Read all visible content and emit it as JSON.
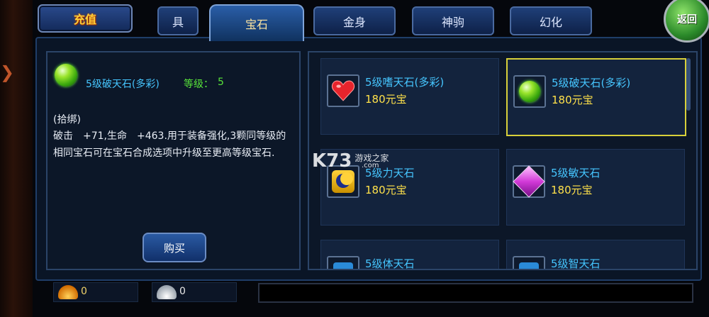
{
  "tabs": {
    "recharge": "充值",
    "partial_tab": "具",
    "gem": "宝石",
    "golden_body": "金身",
    "steed": "神驹",
    "transform": "幻化",
    "back": "返回"
  },
  "detail": {
    "gem_icon": "green-gem-icon",
    "title": "5级破天石(多彩)",
    "level_label": "等级：",
    "level_value": "5",
    "bind_text": "(拾绑)",
    "description": "破击　+71,生命　+463.用于装备强化,3颗同等级的相同宝石可在宝石合成选项中升级至更高等级宝石.",
    "buy_label": "购买"
  },
  "items": [
    {
      "name": "5级嗜天石(多彩)",
      "price": "180元宝",
      "icon": "red-heart-gem-icon",
      "selected": false
    },
    {
      "name": "5级破天石(多彩)",
      "price": "180元宝",
      "icon": "green-gem-icon",
      "selected": true
    },
    {
      "name": "5级力天石",
      "price": "180元宝",
      "icon": "moon-star-gem-icon",
      "selected": false
    },
    {
      "name": "5级敏天石",
      "price": "180元宝",
      "icon": "purple-crystal-gem-icon",
      "selected": false
    },
    {
      "name": "5级体天石",
      "price": "",
      "icon": "blue-gem-icon",
      "selected": false
    },
    {
      "name": "5级智天石",
      "price": "",
      "icon": "blue-gem-icon",
      "selected": false
    }
  ],
  "currency": {
    "gold_value": "0",
    "silver_value": "0"
  },
  "watermark": {
    "logo": "K73",
    "text": "游戏之家",
    "url": ".com"
  },
  "colors": {
    "item_name": "#46c6ff",
    "price": "#ffe14a",
    "level": "#58e43a",
    "selected_border": "#d8d03a"
  }
}
